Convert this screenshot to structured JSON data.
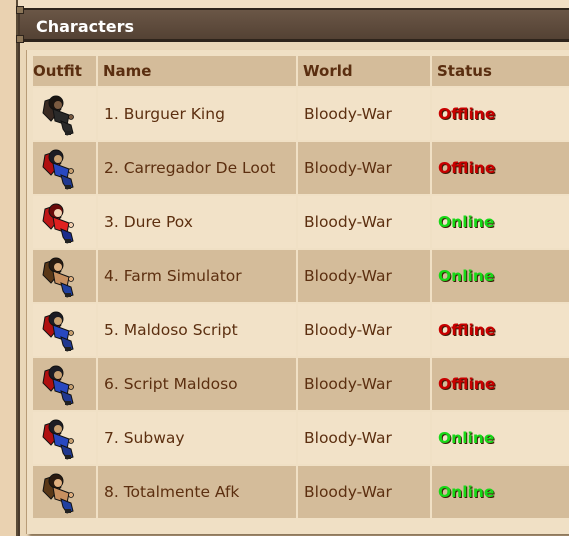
{
  "panel": {
    "title": "Characters",
    "headers": {
      "outfit": "Outfit",
      "name": "Name",
      "world": "World",
      "status": "Status"
    }
  },
  "colors": {
    "online": "#18d818",
    "offline": "#c80000",
    "caption_bg": "#5e4b3c",
    "header_bg": "#d4bc9a"
  },
  "characters": [
    {
      "name": "1. Burguer King",
      "world": "Bloody-War",
      "status": "Offline",
      "outfit_icon": "outfit-dark-warrior-icon"
    },
    {
      "name": "2. Carregador De Loot",
      "world": "Bloody-War",
      "status": "Offline",
      "outfit_icon": "outfit-blue-red-caped-icon"
    },
    {
      "name": "3. Dure Pox",
      "world": "Bloody-War",
      "status": "Online",
      "outfit_icon": "outfit-red-warrior-icon"
    },
    {
      "name": "4. Farm Simulator",
      "world": "Bloody-War",
      "status": "Online",
      "outfit_icon": "outfit-brown-blue-icon"
    },
    {
      "name": "5. Maldoso Script",
      "world": "Bloody-War",
      "status": "Offline",
      "outfit_icon": "outfit-blue-red-caped-icon"
    },
    {
      "name": "6. Script Maldoso",
      "world": "Bloody-War",
      "status": "Offline",
      "outfit_icon": "outfit-blue-red-caped-icon"
    },
    {
      "name": "7. Subway",
      "world": "Bloody-War",
      "status": "Online",
      "outfit_icon": "outfit-blue-red-caped-icon"
    },
    {
      "name": "8. Totalmente Afk",
      "world": "Bloody-War",
      "status": "Online",
      "outfit_icon": "outfit-brown-blue-icon"
    }
  ]
}
